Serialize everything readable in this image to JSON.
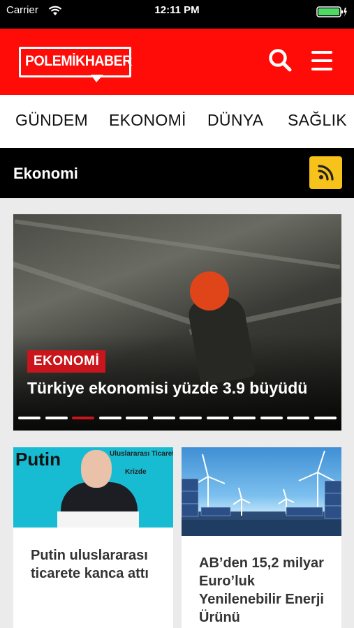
{
  "status_bar": {
    "carrier": "Carrier",
    "time": "12:11 PM"
  },
  "header": {
    "logo_text": "POLEMİKHABER",
    "brand_color": "#ff0b08",
    "icons": [
      "search-icon",
      "hamburger-menu-icon"
    ]
  },
  "categories": [
    "GÜNDEM",
    "EKONOMİ",
    "DÜNYA",
    "SAĞLIK"
  ],
  "section": {
    "title": "Ekonomi",
    "rss_icon": "rss-icon",
    "rss_color": "#f7c21a"
  },
  "slider": {
    "tag": "EKONOMİ",
    "title": "Türkiye ekonomisi yüzde 3.9 büyüdü",
    "total_slides": 12,
    "active_slide": 3
  },
  "cards": [
    {
      "image_text": "Putin",
      "image_text_2": "Uluslararası Ticaret",
      "image_text_3": "Krizde",
      "title": "Putin uluslararası ticarete kanca attı"
    },
    {
      "title": "AB’den 15,2 milyar Euro’luk Yenilenebilir Enerji Ürünü"
    }
  ]
}
